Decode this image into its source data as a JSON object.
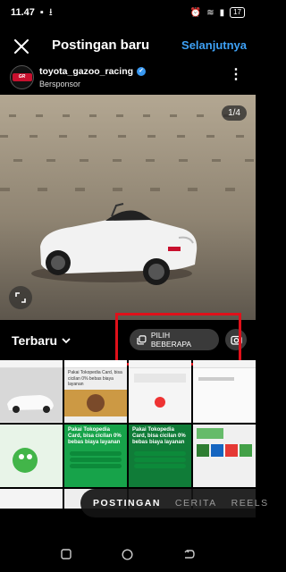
{
  "status": {
    "time": "11.47",
    "battery": "17"
  },
  "header": {
    "title": "Postingan baru",
    "next_label": "Selanjutnya"
  },
  "post": {
    "username": "toyota_gazoo_racing",
    "sponsored": "Bersponsor",
    "avatar_text": "GR"
  },
  "media": {
    "counter": "1/4"
  },
  "gallery": {
    "recent_label": "Terbaru",
    "multi_select_label": "PILIH BEBERAPA"
  },
  "thumbs": [
    {
      "text": ""
    },
    {
      "text": "Pakai Tokopedia Card, bisa cicilan 0% bebas biaya layanan"
    },
    {
      "text": ""
    },
    {
      "text": ""
    },
    {
      "text": ""
    },
    {
      "text": "Pakai Tokopedia Card, bisa cicilan 0% bebas biaya layanan"
    },
    {
      "text": "Pakai Tokopedia Card, bisa cicilan 0% bebas biaya layanan"
    },
    {
      "text": ""
    }
  ],
  "modes": [
    "POSTINGAN",
    "CERITA",
    "REELS"
  ],
  "colors": {
    "accent": "#3ea1f5",
    "highlight": "#e0101a",
    "brand_red": "#c8102e"
  }
}
